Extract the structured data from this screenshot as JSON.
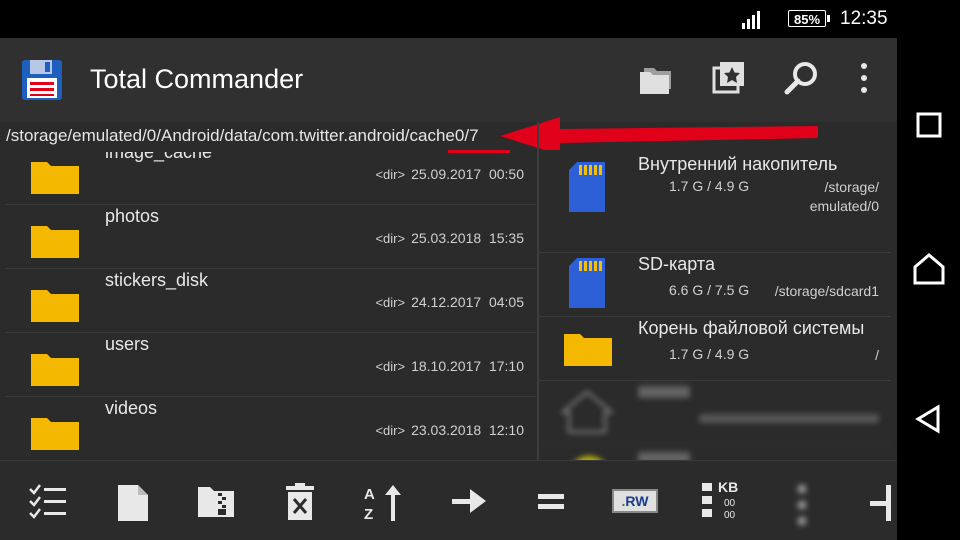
{
  "status_bar": {
    "battery": "85%",
    "time": "12:35"
  },
  "app": {
    "title": "Total Commander",
    "toolbar_icons": [
      "folders-icon",
      "bookmarks-star-icon",
      "search-icon",
      "more-vert-icon"
    ]
  },
  "path": {
    "prefix": "/storage/emulated/0/Android/data/com.twitter.android/",
    "highlighted": "cache",
    "count": "0/7"
  },
  "left_pane": {
    "files": [
      {
        "name": "image_cache",
        "type": "<dir>",
        "date": "25.09.2017",
        "time": "00:50"
      },
      {
        "name": "photos",
        "type": "<dir>",
        "date": "25.03.2018",
        "time": "15:35"
      },
      {
        "name": "stickers_disk",
        "type": "<dir>",
        "date": "24.12.2017",
        "time": "04:05"
      },
      {
        "name": "users",
        "type": "<dir>",
        "date": "18.10.2017",
        "time": "17:10"
      },
      {
        "name": "videos",
        "type": "<dir>",
        "date": "23.03.2018",
        "time": "12:10"
      }
    ]
  },
  "right_pane": {
    "volumes": [
      {
        "name": "Внутренний накопитель",
        "size": "1.7 G / 4.9 G",
        "path_line1": "/storage/",
        "path_line2": "emulated/0"
      },
      {
        "name": "SD-карта",
        "size": "6.6 G / 7.5 G",
        "path_line1": "/storage/sdcard1"
      },
      {
        "name": "Корень файловой системы",
        "size": "1.7 G / 4.9 G",
        "path_line1": "/"
      }
    ]
  },
  "bottom_bar": {
    "icons": [
      "select-list-icon",
      "new-file-icon",
      "zip-icon",
      "delete-icon",
      "sort-icon",
      "arrow-right-icon",
      "equals-icon",
      "rw-icon",
      "view-size-icon",
      "more-icon",
      "split-icon"
    ],
    "rw_label": "RW",
    "kb_label": "KB"
  },
  "nav_bar": {
    "icons": [
      "recents-icon",
      "home-icon",
      "back-icon"
    ]
  },
  "colors": {
    "accent_red": "#e0001a",
    "folder_yellow": "#f5b800",
    "sd_blue": "#2d5fd6",
    "background": "#2b2b2b"
  }
}
